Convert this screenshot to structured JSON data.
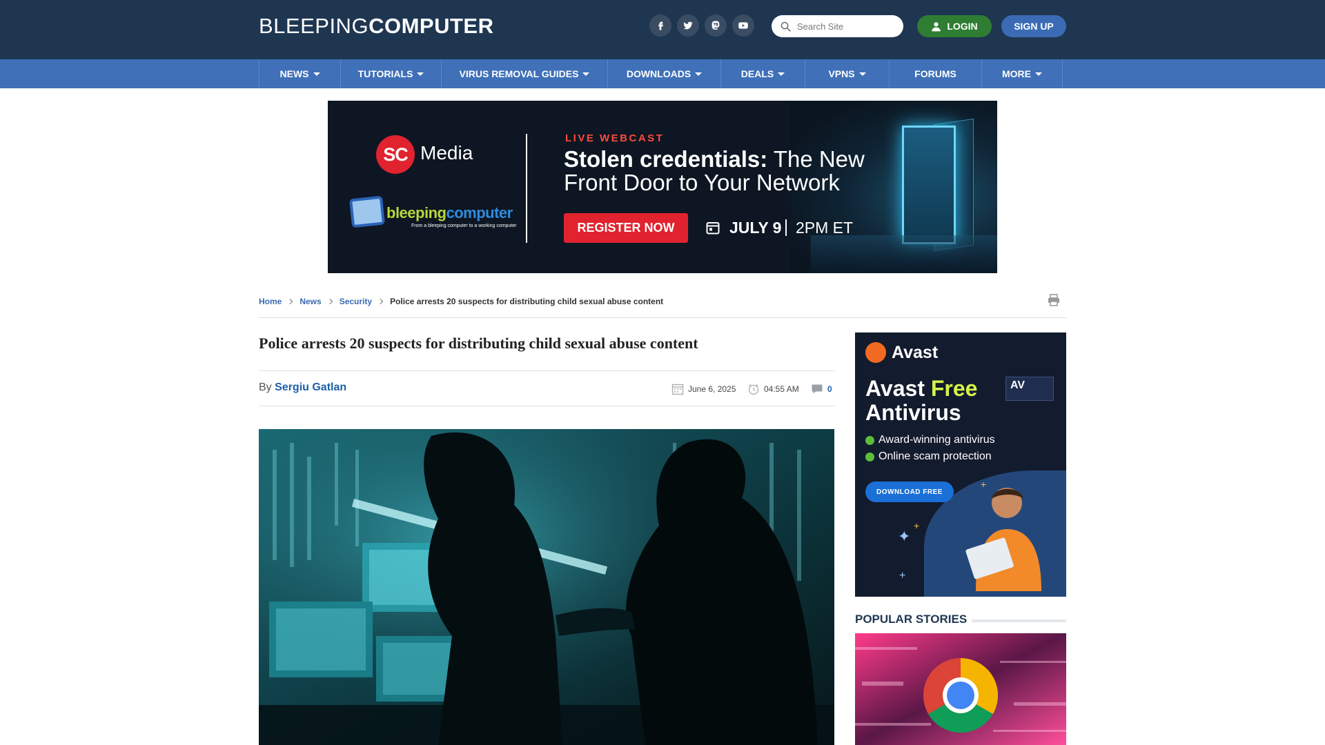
{
  "header": {
    "logo_light": "BLEEPING",
    "logo_bold": "COMPUTER",
    "social_icons": [
      "facebook-icon",
      "twitter-icon",
      "mastodon-icon",
      "youtube-icon"
    ],
    "search_placeholder": "Search Site",
    "login_label": "LOGIN",
    "signup_label": "SIGN UP"
  },
  "nav": [
    {
      "label": "NEWS",
      "has_dropdown": true
    },
    {
      "label": "TUTORIALS",
      "has_dropdown": true
    },
    {
      "label": "VIRUS REMOVAL GUIDES",
      "has_dropdown": true
    },
    {
      "label": "DOWNLOADS",
      "has_dropdown": true
    },
    {
      "label": "DEALS",
      "has_dropdown": true
    },
    {
      "label": "VPNS",
      "has_dropdown": true
    },
    {
      "label": "FORUMS",
      "has_dropdown": false
    },
    {
      "label": "MORE",
      "has_dropdown": true
    }
  ],
  "banner_ad": {
    "brand_mark": "SC",
    "brand": "Media",
    "partner_a": "bleeping",
    "partner_b": "computer",
    "partner_tagline": "From a bleeping computer to a working computer",
    "kicker": "LIVE WEBCAST",
    "headline_bold": "Stolen credentials:",
    "headline_rest_1": " The New",
    "headline_line2": "Front Door to Your Network",
    "cta": "REGISTER NOW",
    "date": "JULY 9",
    "time": "2PM ET"
  },
  "breadcrumb": {
    "items": [
      "Home",
      "News",
      "Security"
    ],
    "current": "Police arrests 20 suspects for distributing child sexual abuse content"
  },
  "article": {
    "title": "Police arrests 20 suspects for distributing child sexual abuse content",
    "by_label": "By",
    "author": "Sergiu Gatlan",
    "date": "June 6, 2025",
    "time": "04:55 AM",
    "comments": "0"
  },
  "sidebar": {
    "ad": {
      "brand": "Avast",
      "title_word": "Avast",
      "title_free": "Free",
      "title_line2": "Antivirus",
      "badge": "AV",
      "features": [
        "Award-winning antivirus",
        "Online scam protection"
      ],
      "cta": "DOWNLOAD FREE"
    },
    "popular_title": "POPULAR STORIES"
  },
  "colors": {
    "header_bg": "#1f3651",
    "nav_bg": "#3f70b8",
    "login_green": "#2e7d32",
    "signup_blue": "#3a6bb4",
    "link_blue": "#1c5fa8",
    "ad_red": "#e0232e"
  }
}
